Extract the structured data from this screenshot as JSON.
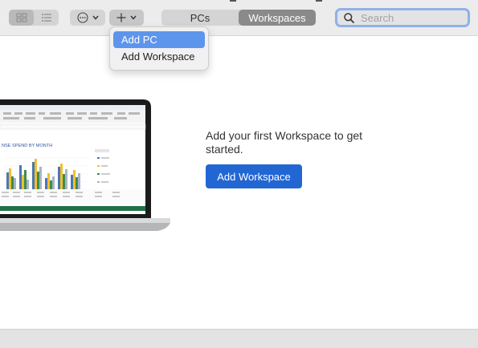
{
  "toolbar": {
    "view_modes": [
      {
        "icon": "grid-view-icon",
        "active": true
      },
      {
        "icon": "list-view-icon",
        "active": false
      }
    ],
    "more_icon": "ellipsis-circle-icon",
    "add_icon": "plus-icon",
    "tabs": [
      {
        "label": "PCs",
        "active": false
      },
      {
        "label": "Workspaces",
        "active": true
      }
    ],
    "search": {
      "placeholder": "Search",
      "value": ""
    }
  },
  "add_menu": {
    "items": [
      {
        "label": "Add PC",
        "highlighted": true
      },
      {
        "label": "Add Workspace",
        "highlighted": false
      }
    ]
  },
  "main": {
    "message": "Add your first Workspace to get started.",
    "button_label": "Add Workspace",
    "illustration": {
      "chart_title": "NSE SPEND BY MONTH"
    }
  },
  "colors": {
    "accent": "#2266d4",
    "menu_highlight": "#5e95ec",
    "search_focus": "#8eb1e8"
  }
}
